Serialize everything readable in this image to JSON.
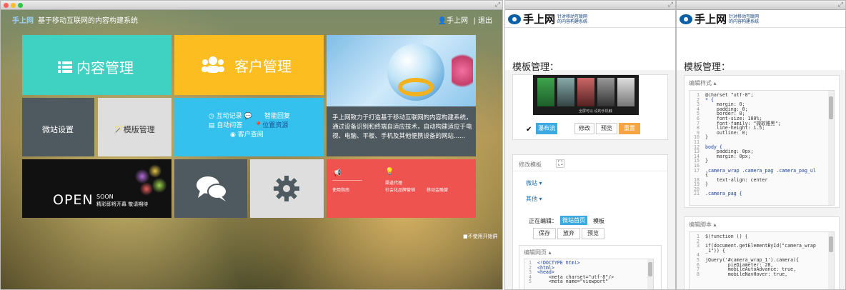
{
  "main_window": {
    "header": {
      "logo": "手上网",
      "tagline": "基于移动互联网的内容构建系统",
      "user": "手上网",
      "logout": "退出"
    },
    "tiles": {
      "content": "内容管理",
      "customer": "客户管理",
      "weizhan": "微站设置",
      "template": "模版管理",
      "cust_links": [
        "互动记录",
        "智能回复",
        "自动问答",
        "位置资源",
        "客户查阅"
      ],
      "desc": "手上网致力于打造基于移动互联网的内容构建系统，通过设备识别和终端自适应技术，自动构建适应于电视、电脑、平板、手机及其他便携设备的网站......",
      "open": "OPEN",
      "soon": "SOON",
      "open_sub": "精彩即将开幕 敬请期待",
      "red_links": [
        "渠道代理",
        "使用指南",
        "社会化品牌营销",
        "移动金融营"
      ]
    },
    "bottom_toggle": "不使用开始屏"
  },
  "win2": {
    "logo": "手上网",
    "logo_sub": [
      "针对移动互联网",
      "的内容构建系统"
    ],
    "title": "模板管理：",
    "thumb_label": "全屏可以 设的手机触",
    "publish": "瀑布流",
    "actions": [
      "修改",
      "预览",
      "重置"
    ],
    "modify_title": "修改模板",
    "menu": [
      "微站",
      "其他"
    ],
    "editing_label": "正在编辑：",
    "editing_tag": "微站首页",
    "editing_suffix": "模板",
    "edit_btns": [
      "保存",
      "放弃",
      "预览"
    ],
    "code_title": "编辑网页",
    "code_lines": [
      "<!DOCTYPE html>",
      "<html>",
      "<head>",
      "    <meta charset=\"utf-8\"/>",
      "    <meta name=\"viewport\""
    ],
    "line_nums": [
      "1",
      "2",
      "3",
      "4",
      "5"
    ]
  },
  "win3": {
    "logo": "手上网",
    "logo_sub": [
      "针对移动互联网",
      "的内容构建系统"
    ],
    "title": "模板管理：",
    "css_title": "编辑样式",
    "css_lines": [
      "@charset \"utf-8\";",
      "* {",
      "    margin: 0;",
      "    padding: 0;",
      "    border: 0;",
      "    font-size: 100%;",
      "    font-family: \"微软雅黑\";",
      "    line-height: 1.5;",
      "    outline: 0;",
      "}",
      "",
      "body {",
      "    padding: 0px;",
      "    margin: 0px;",
      "}",
      "",
      ".camera_wrap .camera_pag .camera_pag_ul",
      "{",
      "    text-align: center",
      "}",
      "",
      ".camera_pag {"
    ],
    "css_nums": [
      "1",
      "2",
      "3",
      "4",
      "5",
      "6",
      "7",
      "8",
      "9",
      "10",
      "11",
      "12",
      "13",
      "14",
      "15",
      "16",
      "17",
      "",
      "18",
      "19",
      "20",
      "21"
    ],
    "js_title": "编辑脚本",
    "js_lines": [
      "$(function () {",
      "",
      "if(document.getElementById(\"camera_wrap",
      "_1\")) {",
      "",
      "jQuery('#camera_wrap_1').camera({",
      "        pieDiameter: 28,",
      "        mobileAutoAdvance: true,",
      "        mobileNavHover: true,"
    ],
    "js_nums": [
      "1",
      "2",
      "3",
      "",
      "4",
      "5",
      "6",
      "7",
      "8"
    ]
  }
}
